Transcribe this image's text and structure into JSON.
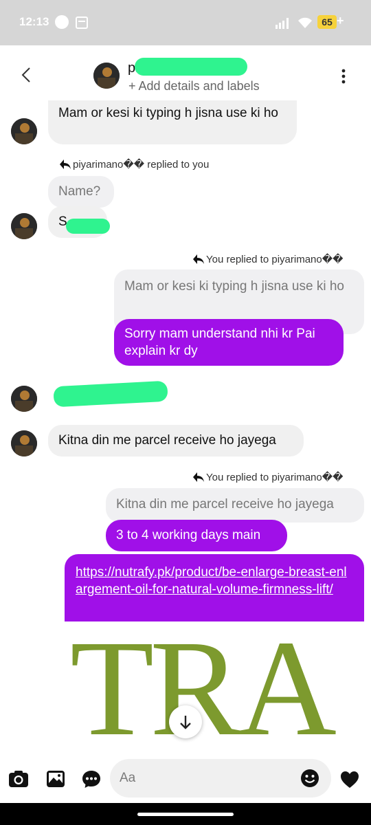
{
  "status": {
    "time": "12:13",
    "battery": "65",
    "battery_plus": "+"
  },
  "header": {
    "name": "pi",
    "subtitle": "+ Add details and labels"
  },
  "messages": {
    "m1": "Mam or kesi ki typing h   jisna use ki ho",
    "reply1": "piyarimano�� replied to you",
    "m2_quoted": "Name?",
    "m2": "S",
    "reply2": "You replied to piyarimano��",
    "m3_quoted": "Mam or kesi ki typing h   jisna use ki ho",
    "m3": "Sorry mam understand nhi kr Pai explain kr dy",
    "m5": "Kitna din me parcel receive ho jayega",
    "reply3": "You replied to piyarimano��",
    "m6_quoted": "Kitna din me parcel receive ho jayega",
    "m6": "3 to 4 working days main",
    "link": "https://nutrafy.pk/product/be-enlarge-breast-enlargement-oil-for-natural-volume-firmness-lift/",
    "preview_text": "TRA"
  },
  "composer": {
    "placeholder": "Aa"
  },
  "colors": {
    "sent_bubble": "#a010e8",
    "mask": "#2ff38f",
    "preview_green": "#7d9a2e"
  },
  "icons": [
    "back-icon",
    "more-icon",
    "camera-icon",
    "gallery-icon",
    "chat-bubble-icon",
    "emoji-icon",
    "heart-icon",
    "arrow-down-icon",
    "reply-arrow-icon"
  ]
}
